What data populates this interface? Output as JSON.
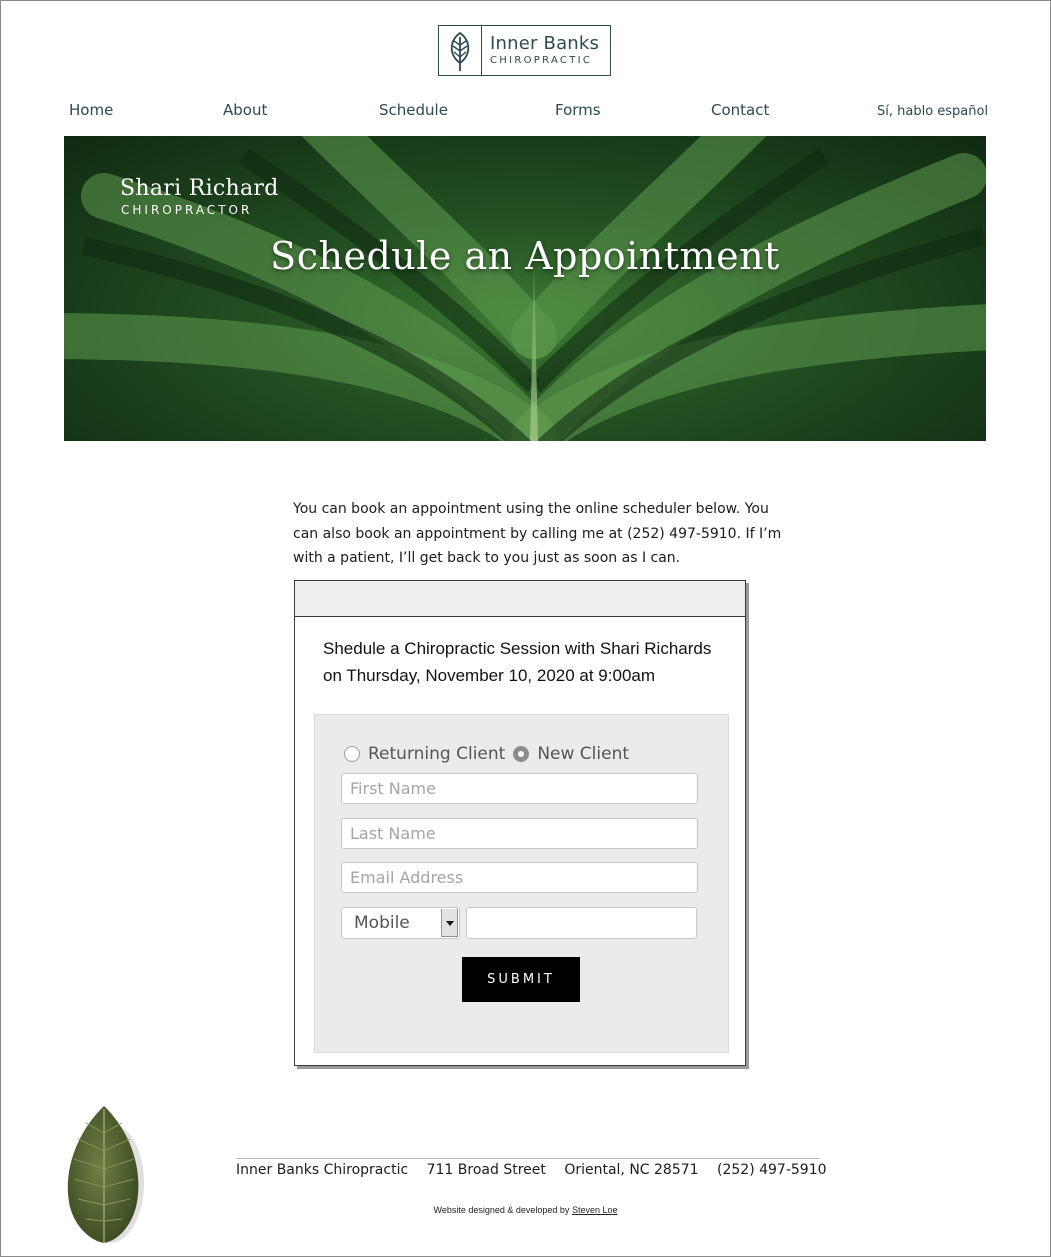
{
  "logo": {
    "name": "Inner Banks",
    "sub": "CHIROPRACTIC"
  },
  "nav": {
    "items": [
      "Home",
      "About",
      "Schedule",
      "Forms",
      "Contact"
    ],
    "spanish": "Sí, hablo español"
  },
  "hero": {
    "name": "Shari Richard",
    "role": "CHIROPRACTOR",
    "title": "Schedule an Appointment"
  },
  "intro": "You can book an appointment using the online scheduler below. You can also book an appointment by calling me at (252) 497-5910. If I’m with a patient, I’ll get back to you just as soon as I can.",
  "widget": {
    "title_line1": "Shedule a Chiropractic Session with Shari Richards",
    "title_line2": "on Thursday, November 10, 2020 at 9:00am",
    "radio_returning": "Returning Client",
    "radio_new": "New Client",
    "selected_client_type": "New Client",
    "first_name_placeholder": "First Name",
    "last_name_placeholder": "Last Name",
    "email_placeholder": "Email Address",
    "phone_type": "Mobile",
    "submit_label": "SUBMIT"
  },
  "footer": {
    "business": "Inner Banks Chiropractic",
    "street": "711 Broad Street",
    "city": "Oriental, NC  28571",
    "phone": "(252) 497-5910",
    "credit_prefix": "Website designed & developed by",
    "credit_name": "Steven Loe"
  },
  "colors": {
    "nav_text": "#2b4a55",
    "hero_green": "#2f6a2a",
    "button": "#000000"
  }
}
